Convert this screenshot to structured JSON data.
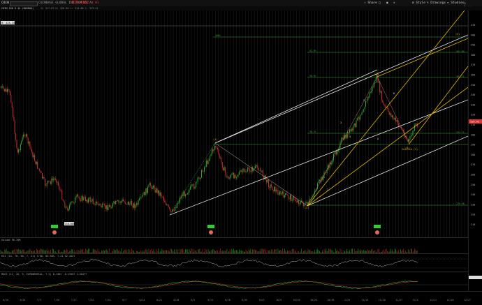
{
  "header": {
    "symbol": "COIN",
    "company": "COINBASE GLOBAL INC COM CL A",
    "price": "319.4162",
    "change": "-0.01",
    "buttons": [
      {
        "label": "Share",
        "icon": "share-icon"
      },
      {
        "label": "Style",
        "icon": "style-icon"
      },
      {
        "label": "Drawings",
        "icon": "pencil-icon"
      },
      {
        "label": "Studies",
        "icon": "flask-icon"
      },
      {
        "label": "Patterns",
        "icon": "patterns-icon"
      }
    ]
  },
  "info": {
    "title": "COIN 180 D 4h (NASDAQ)",
    "ohlc": "O: 317.67  H: 320.50  L: 314.88  C: 319.41",
    "hi_marker": "H: 425.34"
  },
  "price_axis": [
    "410",
    "400",
    "390",
    "380",
    "370",
    "360",
    "350",
    "340",
    "330",
    "320",
    "310",
    "300",
    "290",
    "280",
    "270",
    "260",
    "250",
    "240",
    "230",
    "220",
    "210"
  ],
  "current_price_tag": "319.41",
  "date_axis": [
    "6/19",
    "6/26",
    "7/3",
    "7/10",
    "7/17",
    "7/24",
    "7/31",
    "8/7",
    "8/14",
    "8/21",
    "8/28",
    "9/4",
    "9/11",
    "9/18",
    "9/25",
    "10/2",
    "10/9",
    "10/16",
    "10/23",
    "10/30",
    "11/6",
    "11/13",
    "11/20",
    "11/27",
    "12/4",
    "12/11",
    "12/18",
    "12/27"
  ],
  "wave_labels": [
    "(1)",
    "(2)",
    "(3)",
    "(4)",
    "(5)",
    "1",
    "2",
    "3",
    "4",
    "5",
    "A",
    "B",
    "C"
  ],
  "annotations": {
    "invalid_wave": "Invalid (2)",
    "low_label": "216.0000",
    "fib_levels": [
      "61.8%",
      "50.0%",
      "38.2%",
      "23.6%",
      "0.0%",
      "100%",
      "78.6%"
    ],
    "fib_values": [
      "403.86",
      "381.21",
      "352.96",
      "324.71",
      "296.46",
      "225.48"
    ]
  },
  "panels": {
    "volume": {
      "label": "Volume",
      "value": "96.39M"
    },
    "rsi": {
      "label": "RSI (14, 70, 30, 7, 21) 3.90, 65.58%, 7.21  52.4427",
      "values": [
        "70",
        "30"
      ]
    },
    "macd": {
      "label": "MACD (12, 26, 9, EXPONENTIAL, 7.2) 0.1362  -0.17857  1.56477"
    }
  },
  "colors": {
    "up": "#2eb82e",
    "down": "#d33",
    "channel": "#e6e6e6",
    "fib": "#3fa03f",
    "pitchfork": "#e6b800",
    "accent": "#1a8cff"
  }
}
